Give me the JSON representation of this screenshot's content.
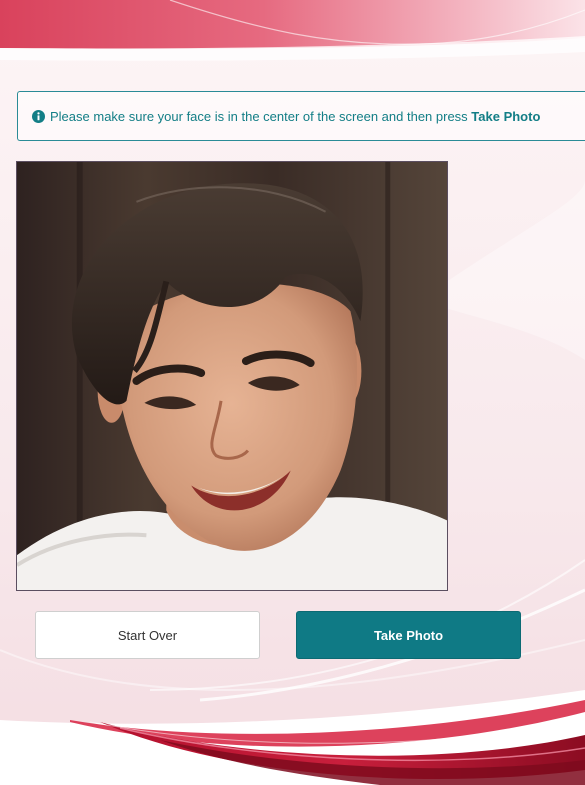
{
  "banner": {
    "icon": "info-circle-icon",
    "text": "Please make sure your face is in the center of the screen and then press ",
    "emphasis": "Take Photo"
  },
  "camera": {
    "content": "camera-preview"
  },
  "buttons": {
    "start_over": "Start Over",
    "take_photo": "Take Photo"
  },
  "colors": {
    "accent": "#0f7a85",
    "banner_text": "#137e86",
    "brand_red": "#c8213d"
  }
}
